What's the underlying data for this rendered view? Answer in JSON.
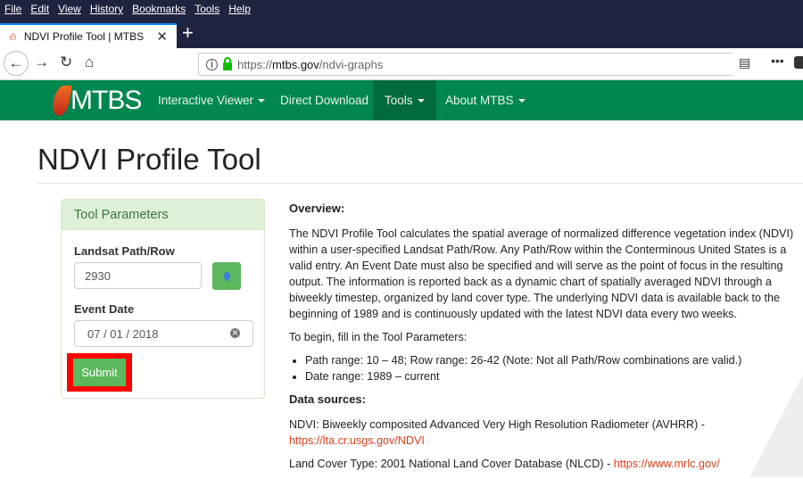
{
  "browser": {
    "menu": [
      "File",
      "Edit",
      "View",
      "History",
      "Bookmarks",
      "Tools",
      "Help"
    ],
    "tab_title": "NDVI Profile Tool | MTBS",
    "url_prefix": "https://",
    "url_domain": "mtbs.gov",
    "url_path": "/ndvi-graphs"
  },
  "nav": {
    "logo": "MTBS",
    "items": [
      "Interactive Viewer",
      "Direct Download",
      "Tools",
      "About MTBS"
    ]
  },
  "page": {
    "title": "NDVI Profile Tool"
  },
  "panel": {
    "title": "Tool Parameters",
    "path_label": "Landsat Path/Row",
    "path_value": "2930",
    "date_label": "Event Date",
    "date_value": "07 / 01 / 2018",
    "submit": "Submit"
  },
  "content": {
    "overview_heading": "Overview:",
    "overview": "The NDVI Profile Tool calculates the spatial average of normalized difference vegetation index (NDVI) within a user-specified Landsat Path/Row. Any Path/Row within the Conterminous United States is a valid entry. An Event Date must also be specified and will serve as the point of focus in the resulting output. The information is reported back as a dynamic chart of spatially averaged NDVI through a biweekly timestep, organized by land cover type. The underlying NDVI data is available back to the beginning of 1989 and is continuously updated with the latest NDVI data every two weeks.",
    "begin": "To begin, fill in the Tool Parameters:",
    "bullets": [
      "Path range: 10 – 48; Row range: 26-42 (Note: Not all Path/Row combinations are valid.)",
      "Date range: 1989 – current"
    ],
    "sources_heading": "Data sources:",
    "ndvi_text": "NDVI: Biweekly composited Advanced Very High Resolution Radiometer (AVHRR) -",
    "ndvi_link": "https://lta.cr.usgs.gov/NDVI",
    "lc_text": "Land Cover Type: 2001 National Land Cover Database (NLCD) -",
    "lc_link": "https://www.mrlc.gov/"
  }
}
